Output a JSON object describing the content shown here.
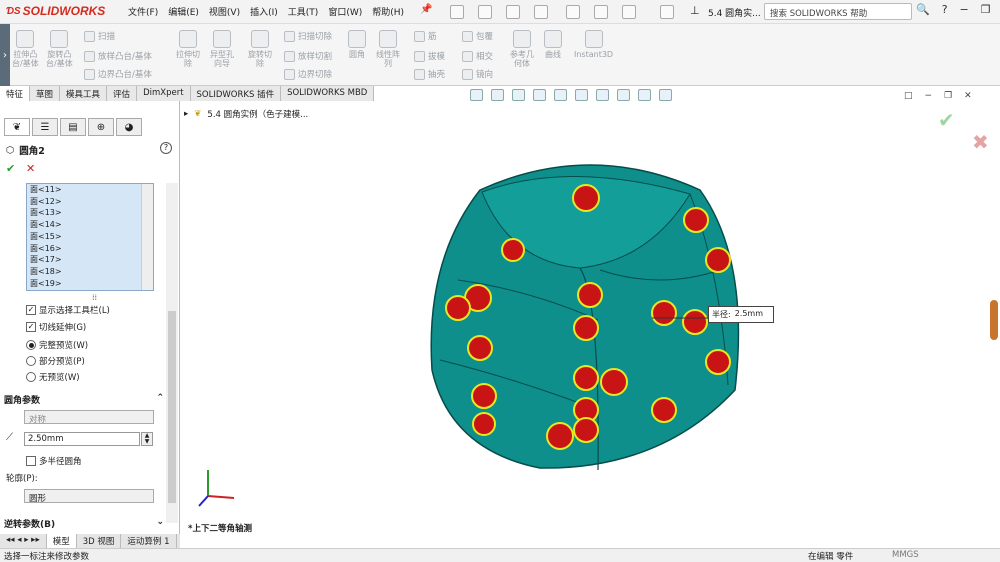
{
  "app": {
    "logo": "SOLIDWORKS",
    "doc_title": "5.4 圆角实...",
    "search_placeholder": "搜索 SOLIDWORKS 帮助"
  },
  "menu": [
    "文件(F)",
    "编辑(E)",
    "视图(V)",
    "插入(I)",
    "工具(T)",
    "窗口(W)",
    "帮助(H)"
  ],
  "ribbon": {
    "large": [
      {
        "label": "拉伸凸\n台/基体"
      },
      {
        "label": "旋转凸\n台/基体"
      },
      {
        "label": "拉伸切\n除"
      },
      {
        "label": "异型孔\n向导"
      },
      {
        "label": "旋转切\n除"
      },
      {
        "label": "圆角"
      },
      {
        "label": "线性阵\n列"
      },
      {
        "label": "参考几\n何体"
      },
      {
        "label": "曲线"
      },
      {
        "label": "Instant3D"
      }
    ],
    "small": [
      "扫描",
      "放样凸台/基体",
      "边界凸台/基体",
      "扫描切除",
      "放样切割",
      "边界切除",
      "筋",
      "拔模",
      "抽壳",
      "包覆",
      "相交",
      "镜向"
    ]
  },
  "tabs": [
    "特征",
    "草图",
    "模具工具",
    "评估",
    "DimXpert",
    "SOLIDWORKS 插件",
    "SOLIDWORKS MBD"
  ],
  "active_tab": "特征",
  "property_manager": {
    "title": "圆角2",
    "faces": [
      "面<11>",
      "面<12>",
      "面<13>",
      "面<14>",
      "面<15>",
      "面<16>",
      "面<17>",
      "面<18>",
      "面<19>"
    ],
    "checkboxes": [
      {
        "label": "显示选择工具栏(L)",
        "checked": true
      },
      {
        "label": "切线延伸(G)",
        "checked": true
      }
    ],
    "radios": [
      {
        "label": "完整预览(W)",
        "on": true
      },
      {
        "label": "部分预览(P)",
        "on": false
      },
      {
        "label": "无预览(W)",
        "on": false
      }
    ],
    "section_params": "圆角参数",
    "symmetric": "对称",
    "radius": "2.50mm",
    "multi_radius": "多半径圆角",
    "profile_label": "轮廓(P):",
    "profile_value": "圆形",
    "section_reverse": "逆转参数(B)"
  },
  "tree_item": "5.4 圆角实例（色子建模...",
  "view_name": "*上下二等角轴测",
  "callout": {
    "label": "半径:",
    "value": "2.5mm"
  },
  "bottom_tabs": [
    "模型",
    "3D 视图",
    "运动算例 1"
  ],
  "status": {
    "left": "选择一标注来修改参数",
    "mode": "在编辑 零件",
    "units": "MMGS"
  },
  "colors": {
    "model": "#0e8f8c",
    "handle": "#e8e820",
    "fillet_red": "#c81414"
  }
}
